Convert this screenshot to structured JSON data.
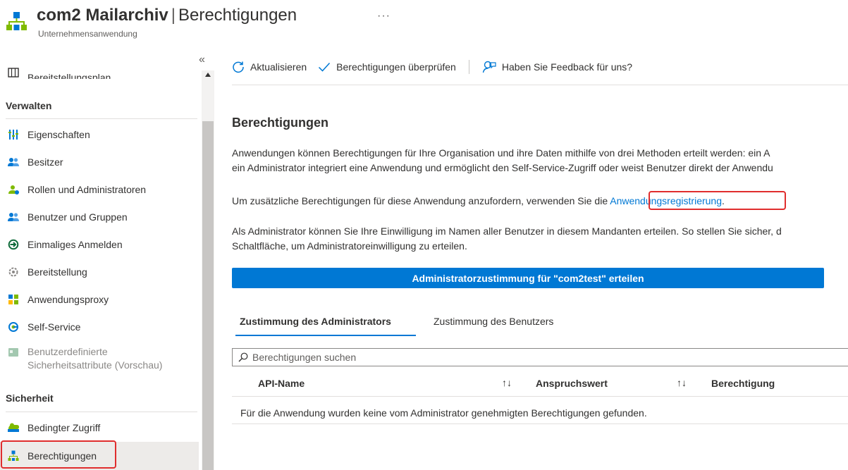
{
  "header": {
    "app_name": "com2 Mailarchiv",
    "separator": "|",
    "page_name": "Berechtigungen",
    "more": "···",
    "subtitle": "Unternehmensanwendung"
  },
  "sidebar": {
    "collapse_glyph": "«",
    "items": [
      {
        "label": "Bereitstellungsplan",
        "icon": "book-map-icon"
      },
      {
        "label": "Eigenschaften",
        "icon": "properties-bars-icon"
      },
      {
        "label": "Besitzer",
        "icon": "owners-icon"
      },
      {
        "label": "Rollen und Administratoren",
        "icon": "roles-icon"
      },
      {
        "label": "Benutzer und Gruppen",
        "icon": "users-groups-icon"
      },
      {
        "label": "Einmaliges Anmelden",
        "icon": "sso-arrow-icon"
      },
      {
        "label": "Bereitstellung",
        "icon": "provisioning-gear-icon"
      },
      {
        "label": "Anwendungsproxy",
        "icon": "app-proxy-icon"
      },
      {
        "label": "Self-Service",
        "icon": "self-service-icon"
      },
      {
        "label_line1": "Benutzerdefinierte",
        "label_line2": "Sicherheitsattribute (Vorschau)",
        "icon": "custom-attributes-icon"
      },
      {
        "label": "Bedingter Zugriff",
        "icon": "conditional-access-icon"
      },
      {
        "label": "Berechtigungen",
        "icon": "permissions-icon"
      }
    ],
    "sections": {
      "manage": "Verwalten",
      "security": "Sicherheit"
    }
  },
  "toolbar": {
    "refresh": "Aktualisieren",
    "review": "Berechtigungen überprüfen",
    "feedback": "Haben Sie Feedback für uns?"
  },
  "main": {
    "heading": "Berechtigungen",
    "para1_line1": "Anwendungen können Berechtigungen für Ihre Organisation und ihre Daten mithilfe von drei Methoden erteilt werden: ein A",
    "para1_line2": "ein Administrator integriert eine Anwendung und ermöglicht den Self-Service-Zugriff oder weist Benutzer direkt der Anwendu",
    "para2_prefix": "Um zusätzliche Berechtigungen für diese Anwendung anzufordern, verwenden Sie die",
    "para2_link": "Anwendungsregistrierung",
    "para2_suffix": ".",
    "para3_line1": "Als Administrator können Sie Ihre Einwilligung im Namen aller Benutzer in diesem Mandanten erteilen. So stellen Sie sicher, d",
    "para3_line2": "Schaltfläche, um Administratoreinwilligung zu erteilen.",
    "grant_button": "Administratorzustimmung für \"com2test\" erteilen",
    "tabs": [
      "Zustimmung des Administrators",
      "Zustimmung des Benutzers"
    ],
    "search_placeholder": "Berechtigungen suchen",
    "columns": [
      "API-Name",
      "Anspruchswert",
      "Berechtigung"
    ],
    "sort_glyph": "↑↓",
    "empty_message": "Für die Anwendung wurden keine vom Administrator genehmigten Berechtigungen gefunden."
  },
  "colors": {
    "accent": "#0078d4",
    "highlight": "#e02d2d",
    "selected_bg": "#edebe9"
  }
}
